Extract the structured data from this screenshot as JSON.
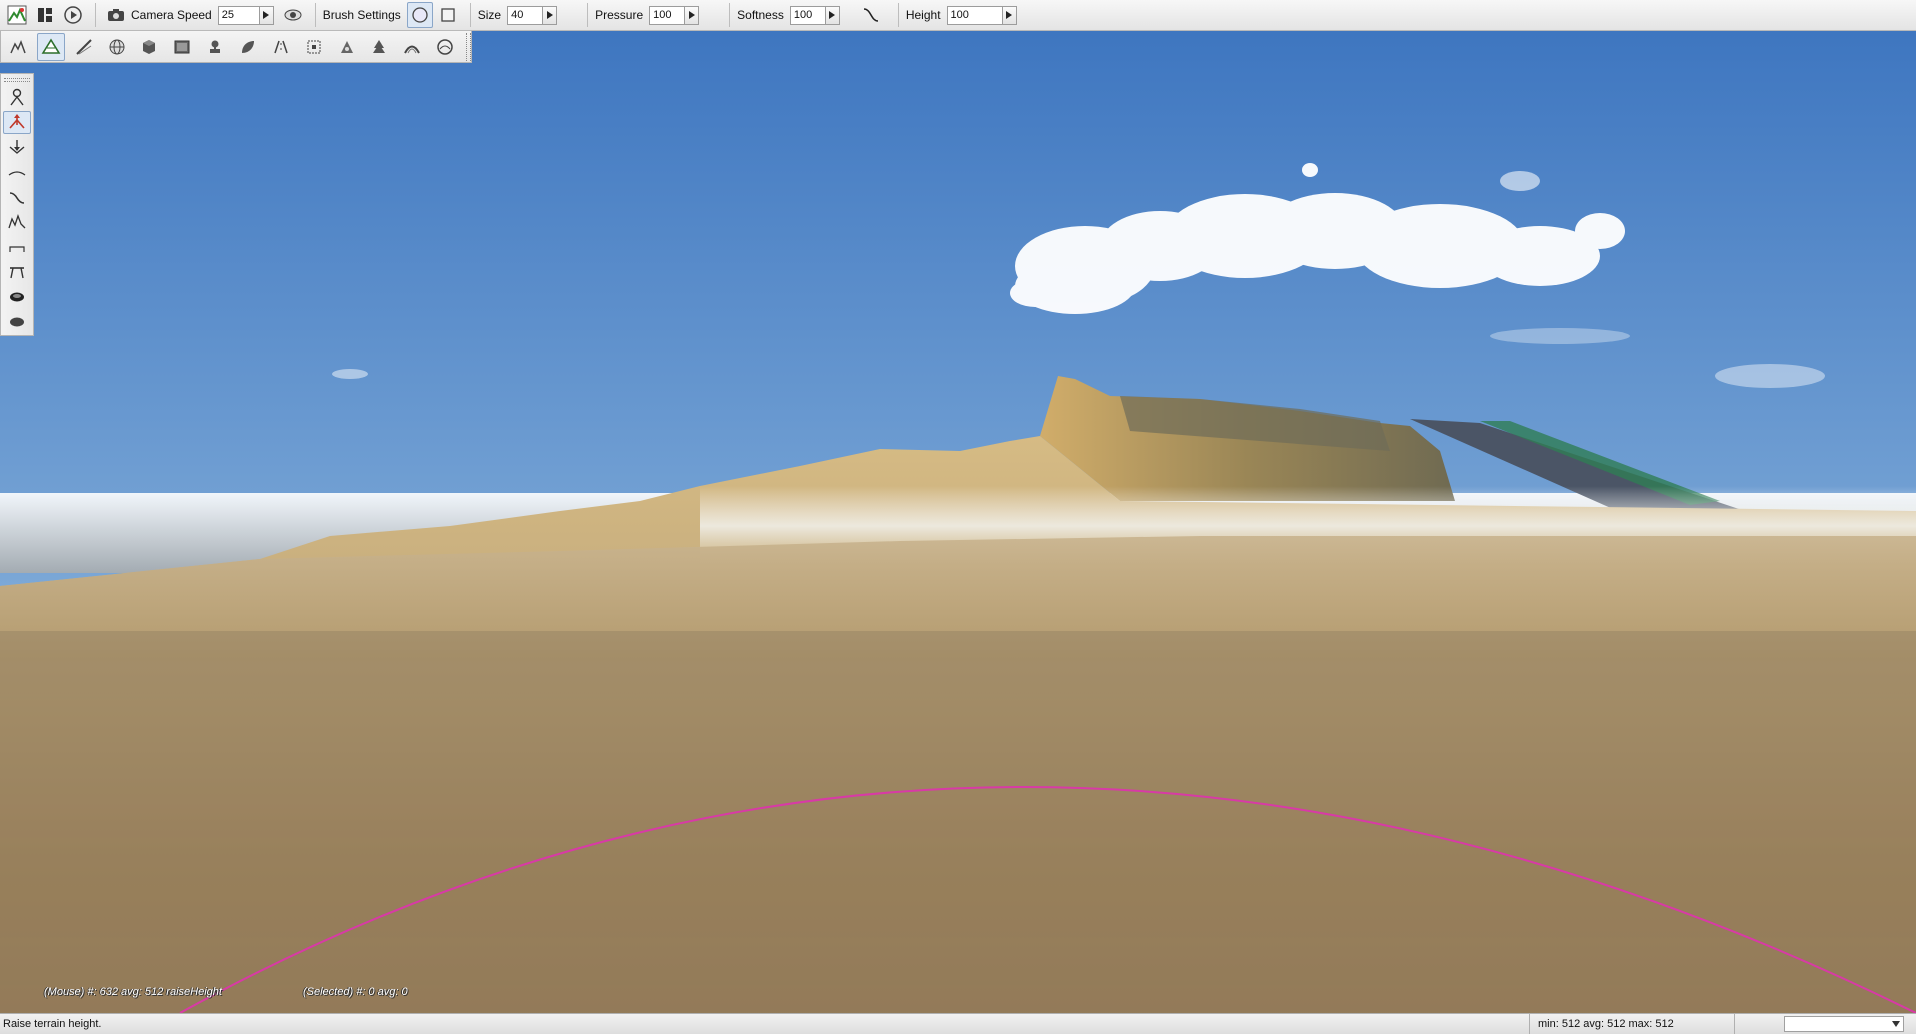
{
  "toolbar": {
    "camera_speed_label": "Camera Speed",
    "camera_speed_value": "25",
    "brush_settings_label": "Brush Settings",
    "size_label": "Size",
    "size_value": "40",
    "pressure_label": "Pressure",
    "pressure_value": "100",
    "softness_label": "Softness",
    "softness_value": "100",
    "height_label": "Height",
    "height_value": "100"
  },
  "icons": {
    "toolbar": [
      "terrain-editor-icon",
      "panel-layout-icon",
      "play-icon",
      "camera-icon",
      "visibility-icon",
      "circle-brush-icon",
      "square-brush-icon",
      "softness-curve-icon"
    ],
    "toolstrip": [
      "select-object-icon",
      "terrain-tool-icon",
      "paint-icon",
      "world-icon",
      "box-icon",
      "image-icon",
      "stamp-icon",
      "leaf-icon",
      "road-icon",
      "transform-icon",
      "decal-icon",
      "forest-icon",
      "mesh-road-icon",
      "river-icon"
    ],
    "palette": [
      "select-icon",
      "raise-height-icon",
      "lower-height-icon",
      "smooth-icon",
      "slope-icon",
      "noise-icon",
      "flatten-icon",
      "set-height-icon",
      "clear-terrain-icon",
      "restore-terrain-icon"
    ]
  },
  "viewport": {
    "mouse_info": "(Mouse) #: 632  avg: 512 raiseHeight",
    "selected_info": "(Selected) #: 0  avg: 0"
  },
  "status": {
    "message": "Raise terrain height.",
    "stats": "min: 512  avg: 512  max: 512"
  },
  "colors": {
    "brush_circle": "#d83aa6",
    "sky_top": "#3f78c2",
    "sky_horizon": "#cbdceb",
    "ground": "#a58a60",
    "active_tool": "#c0392b"
  }
}
